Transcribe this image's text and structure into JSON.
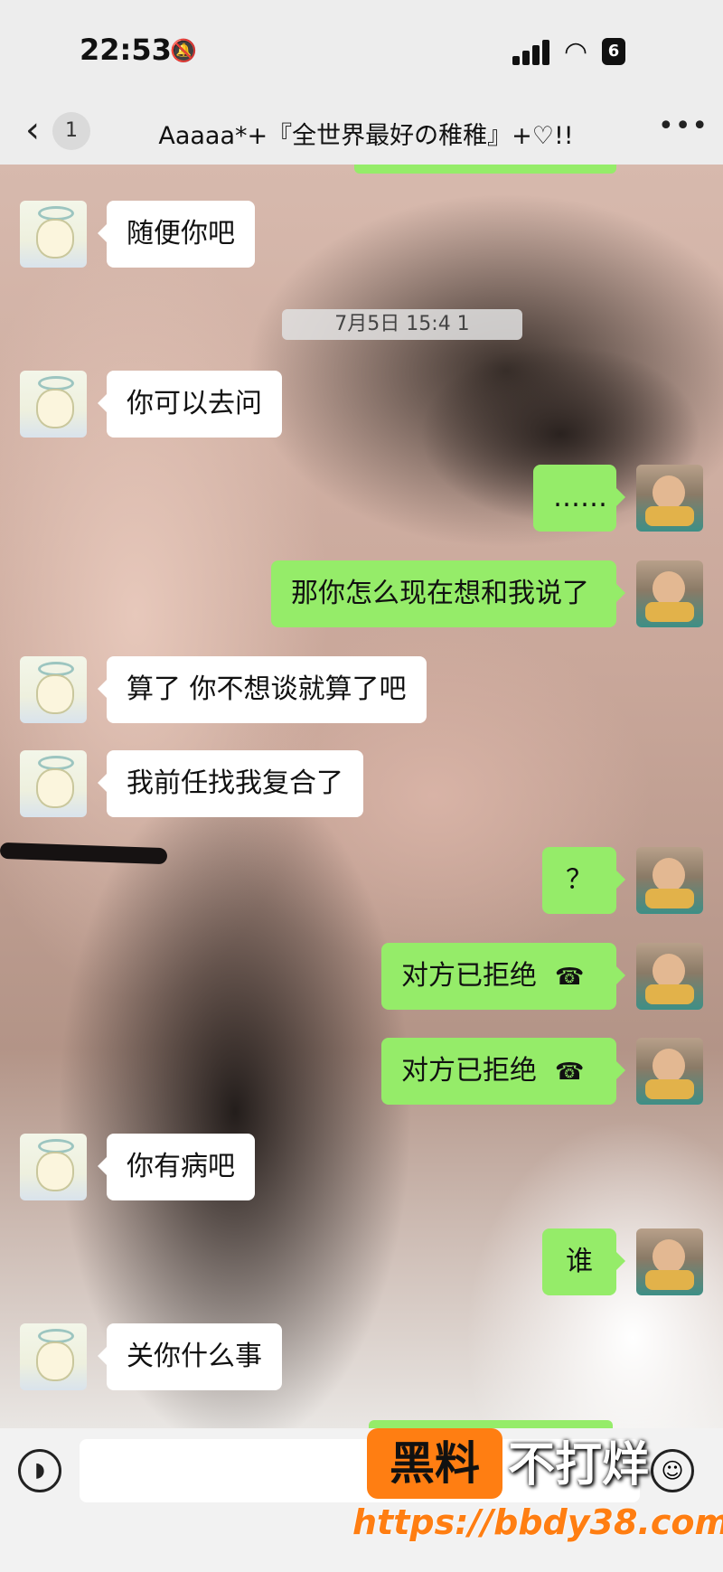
{
  "status_bar": {
    "time": "22:53",
    "mute_icon": "bell-slash-icon",
    "battery_label": "6"
  },
  "nav": {
    "back_icon": "chevron-left-icon",
    "unread_count": "1",
    "title": "Aaaaa*+『全世界最好の稚稚』+♡!!",
    "more_icon": "ellipsis-icon"
  },
  "timestamp": "7月5日 15:4 1",
  "messages": [
    {
      "side": "in",
      "text": "随便你吧"
    },
    {
      "side": "in",
      "text": "你可以去问"
    },
    {
      "side": "out",
      "text": "……"
    },
    {
      "side": "out",
      "text": "那你怎么现在想和我说了"
    },
    {
      "side": "in",
      "text": "算了 你不想谈就算了吧"
    },
    {
      "side": "in",
      "text": "我前任找我复合了"
    },
    {
      "side": "out",
      "text": "？"
    },
    {
      "side": "out",
      "text": "对方已拒绝",
      "call_icon": "phone-hangup-icon"
    },
    {
      "side": "out",
      "text": "对方已拒绝",
      "call_icon": "phone-hangup-icon"
    },
    {
      "side": "in",
      "text": "你有病吧"
    },
    {
      "side": "out",
      "text": "谁"
    },
    {
      "side": "in",
      "text": "关你什么事"
    }
  ],
  "input_bar": {
    "voice_icon": "voice-icon",
    "emoji_icon": "emoji-icon"
  },
  "watermark": {
    "badge": "黑料",
    "text": "不打烊",
    "url": "https://bbdy38.com"
  },
  "colors": {
    "outgoing_bubble": "#95ec69",
    "incoming_bubble": "#ffffff",
    "watermark_orange": "#ff7e12"
  }
}
